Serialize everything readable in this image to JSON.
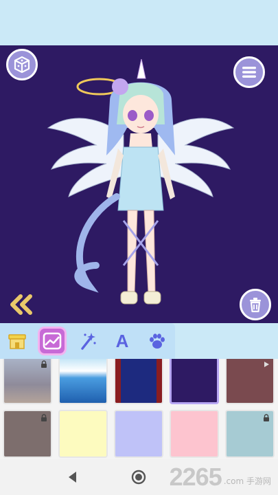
{
  "header": {},
  "stage": {
    "background_color": "#2e1a63",
    "left_button_icon": "dice-cube-icon",
    "right_button_icon": "menu-list-icon",
    "back_icon": "double-chevron-left-icon",
    "trash_icon": "trash-icon"
  },
  "tabs": [
    {
      "icon": "shop-icon",
      "active": false
    },
    {
      "icon": "background-image-icon",
      "active": true
    },
    {
      "icon": "magic-wand-icon",
      "active": false
    },
    {
      "icon": "text-a-icon",
      "active": false
    },
    {
      "icon": "paw-icon",
      "active": false
    }
  ],
  "text_tab_label": "A",
  "backgrounds": [
    {
      "kind": "cloudy-scene",
      "locked": true,
      "color": "#9aa3b9"
    },
    {
      "kind": "ocean",
      "locked": false,
      "color": "#3f8fd6"
    },
    {
      "kind": "stage-curtains",
      "locked": false,
      "color": "#1f2f8a"
    },
    {
      "kind": "solid",
      "locked": false,
      "color": "#2e1a63",
      "selected": true
    },
    {
      "kind": "solid",
      "locked": true,
      "color": "#7a4a4f"
    },
    {
      "kind": "solid",
      "locked": true,
      "color": "#7d6e6d"
    },
    {
      "kind": "solid",
      "locked": false,
      "color": "#fdfbbf"
    },
    {
      "kind": "solid",
      "locked": false,
      "color": "#bfc2f8"
    },
    {
      "kind": "solid",
      "locked": false,
      "color": "#fdc4cf"
    },
    {
      "kind": "solid",
      "locked": true,
      "color": "#a6cbd3"
    }
  ],
  "navigation": {
    "back_icon": "nav-back-icon",
    "home_icon": "nav-home-icon"
  },
  "watermark": {
    "number": "2265",
    "text": ".com 手游网"
  }
}
